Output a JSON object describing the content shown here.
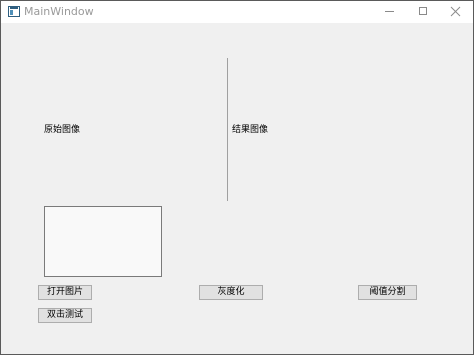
{
  "window": {
    "title": "MainWindow"
  },
  "labels": {
    "original_image": "原始图像",
    "result_image": "结果图像"
  },
  "text_box": {
    "value": ""
  },
  "buttons": {
    "open_image": "打开图片",
    "grayscale": "灰度化",
    "threshold_segmentation": "阈值分割",
    "double_click_test": "双击测试"
  },
  "icons": {
    "app": "app-window-icon",
    "minimize": "minimize-icon",
    "maximize": "maximize-icon",
    "close": "close-icon"
  }
}
